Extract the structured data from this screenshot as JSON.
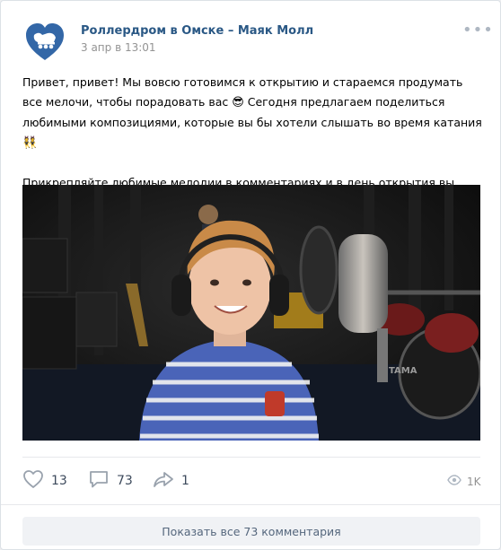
{
  "post": {
    "author": "Роллердром в Омске – Маяк Молл",
    "date": "3 апр в 13:01",
    "text_line1": "Привет, привет! Мы вовсю готовимся к открытию и стараемся продумать все мелочи, чтобы порадовать вас ",
    "emoji1": "😎",
    "text_line2": " Сегодня предлагаем поделиться любимыми композициями, которые вы бы хотели слышать во время катания ",
    "emoji2": "👯",
    "text_para2": "Прикрепляйте любимые мелодии в комментариях и в день открытия вы услышите их на роллердроме ",
    "emoji3": "😜"
  },
  "actions": {
    "likes": "13",
    "comments": "73",
    "shares": "1",
    "views": "1K"
  },
  "footer": {
    "show_comments_label": "Показать все 73 комментария"
  },
  "icons": {
    "like": "heart-icon",
    "comment": "comment-icon",
    "share": "share-icon",
    "views": "eye-icon",
    "more": "more-dots-icon"
  },
  "colors": {
    "link": "#2a5885",
    "avatar": "#3367a7",
    "icon": "#99a2ad"
  }
}
